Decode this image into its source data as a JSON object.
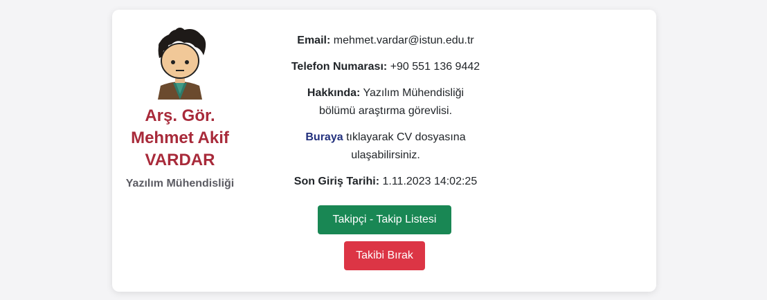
{
  "profile": {
    "name": "Arş. Gör. Mehmet Akif VARDAR",
    "department": "Yazılım Mühendisliği",
    "avatar_icon": "cartoon-avatar-icon"
  },
  "info": {
    "email_label": "Email:",
    "email_value": "mehmet.vardar@istun.edu.tr",
    "phone_label": "Telefon Numarası:",
    "phone_value": "+90 551 136 9442",
    "about_label": "Hakkında:",
    "about_value": "Yazılım Mühendisliği bölümü araştırma görevlisi.",
    "cv_link": "Buraya",
    "cv_text": "tıklayarak CV dosyasına ulaşabilirsiniz.",
    "last_login_label": "Son Giriş Tarihi:",
    "last_login_value": "1.11.2023 14:02:25"
  },
  "buttons": {
    "followers": "Takipçi - Takip Listesi",
    "unfollow": "Takibi Bırak"
  },
  "colors": {
    "name": "#a82a3a",
    "link": "#22307d",
    "success": "#198754",
    "danger": "#dc3545"
  }
}
